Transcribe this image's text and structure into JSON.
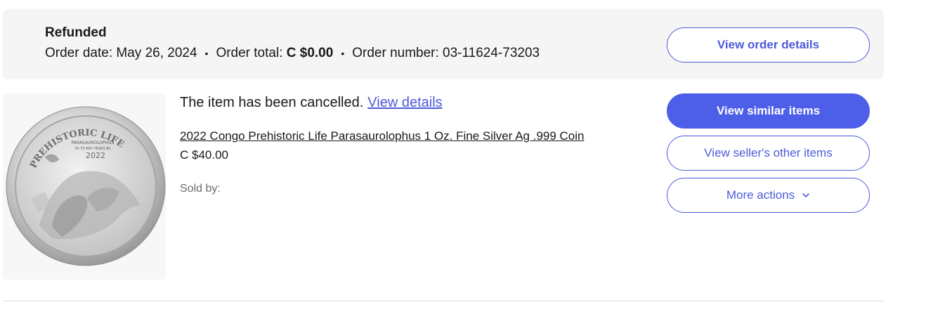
{
  "order": {
    "status": "Refunded",
    "date_label": "Order date:",
    "date_value": "May 26, 2024",
    "total_label": "Order total:",
    "total_value": "C $0.00",
    "number_label": "Order number:",
    "number_value": "03-11624-73203",
    "separator": "•",
    "view_order_details": "View order details"
  },
  "item": {
    "cancel_message": "The item has been cancelled.",
    "view_details_link": "View details",
    "title": "2022 Congo Prehistoric Life Parasaurolophus 1 Oz. Fine Silver Ag .999 Coin",
    "price": "C $40.00",
    "sold_by_label": "Sold by:",
    "image_icon": "silver-coin-image",
    "coin_text": {
      "arc": "PREHISTORIC LIFE",
      "name": "PARASAUROLOPHUS",
      "era": "76-73 MIO YEARS BC",
      "year": "2022"
    }
  },
  "actions": {
    "view_similar": "View similar items",
    "view_seller_items": "View seller's other items",
    "more_actions": "More actions",
    "more_actions_icon": "chevron-down-icon"
  },
  "colors": {
    "accent": "#4d5fe8",
    "link": "#4d5bd9",
    "header_bg": "#f5f5f5"
  }
}
